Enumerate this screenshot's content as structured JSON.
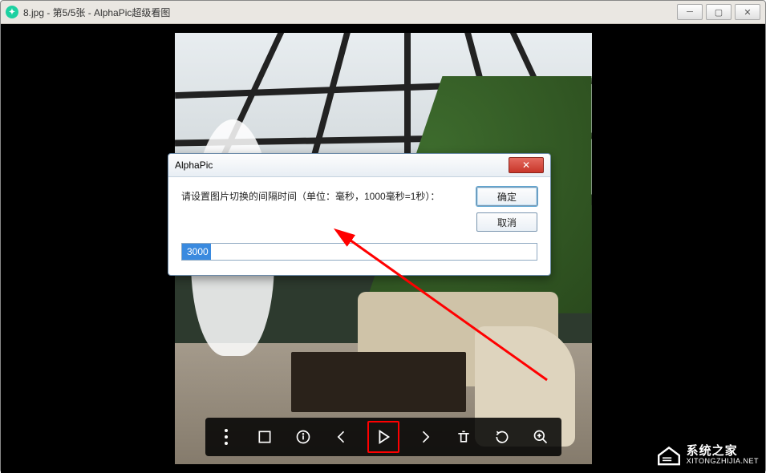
{
  "window": {
    "title": "8.jpg - 第5/5张 - AlphaPic超级看图"
  },
  "dialog": {
    "title": "AlphaPic",
    "prompt": "请设置图片切换的间隔时间（单位：毫秒，1000毫秒=1秒）：",
    "value": "3000",
    "ok_label": "确定",
    "cancel_label": "取消"
  },
  "watermark": {
    "cn": "系统之家",
    "en": "XITONGZHIJIA.NET"
  },
  "toolbar": {
    "more": "more",
    "layout": "layout",
    "info": "info",
    "prev": "prev",
    "play": "play",
    "next": "next",
    "delete": "delete",
    "rotate": "rotate",
    "zoom": "zoom"
  }
}
